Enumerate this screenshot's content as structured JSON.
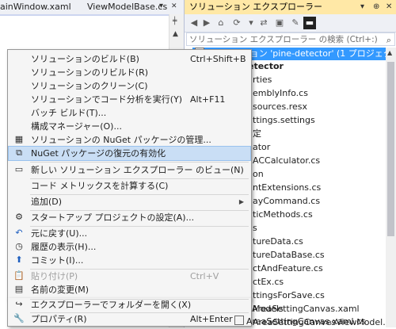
{
  "editor": {
    "tab1": "ainWindow.xaml",
    "tab2": "ViewModelBase.cs"
  },
  "solution_explorer": {
    "title": "ソリューション エクスプローラー",
    "title_buttons": [
      "▾",
      "⊕",
      "✕"
    ],
    "search_placeholder": "ソリューション エクスプローラー の検索 (Ctrl+:)",
    "tree": [
      "ソリューション 'pine-detector' (1 プロジェクト)",
      "etector",
      "rties",
      "emblyInfo.cs",
      "sources.resx",
      "ttings.settings",
      "定",
      "ator",
      "ACCalculator.cs",
      "on",
      "ntExtensions.cs",
      "ayCommand.cs",
      "ticMethods.cs",
      "s",
      "tureData.cs",
      "tureDataBase.cs",
      "ctAndFeature.cs",
      "ctEx.cs",
      "ttingsForSave.cs",
      "Models",
      "AreaSettingCanvesViewModel.cs",
      "inWindowViewModel.cs",
      "wModelBase.cs",
      "",
      "AreaSettingCanvas.xaml",
      "AreaSettingCanvas.xaml.cs"
    ]
  },
  "context_menu": {
    "items": [
      {
        "label": "ソリューションのビルド(B)",
        "shortcut": "Ctrl+Shift+B",
        "icon": ""
      },
      {
        "label": "ソリューションのリビルド(R)",
        "shortcut": "",
        "icon": ""
      },
      {
        "label": "ソリューションのクリーン(C)",
        "shortcut": "",
        "icon": ""
      },
      {
        "label": "ソリューションでコード分析を実行(Y)",
        "shortcut": "Alt+F11",
        "icon": ""
      },
      {
        "label": "バッチ ビルド(T)...",
        "shortcut": "",
        "icon": ""
      },
      {
        "label": "構成マネージャー(O)...",
        "shortcut": "",
        "icon": ""
      },
      {
        "label": "ソリューションの NuGet パッケージの管理...",
        "shortcut": "",
        "icon": "nuget-icon"
      },
      {
        "label": "NuGet パッケージの復元の有効化",
        "shortcut": "",
        "icon": "nuget-restore-icon"
      },
      {
        "label": "新しい ソリューション エクスプローラー のビュー(N)",
        "shortcut": "",
        "icon": "new-view-icon"
      },
      {
        "label": "コード メトリックスを計算する(C)",
        "shortcut": "",
        "icon": ""
      },
      {
        "label": "追加(D)",
        "shortcut": "",
        "icon": ""
      },
      {
        "label": "スタートアップ プロジェクトの設定(A)...",
        "shortcut": "",
        "icon": "gear-icon"
      },
      {
        "label": "元に戻す(U)...",
        "shortcut": "",
        "icon": "undo-icon"
      },
      {
        "label": "履歴の表示(H)...",
        "shortcut": "",
        "icon": "history-icon"
      },
      {
        "label": "コミット(I)...",
        "shortcut": "",
        "icon": "commit-icon"
      },
      {
        "label": "貼り付け(P)",
        "shortcut": "Ctrl+V",
        "icon": "paste-icon"
      },
      {
        "label": "名前の変更(M)",
        "shortcut": "",
        "icon": "rename-icon"
      },
      {
        "label": "エクスプローラーでフォルダーを開く(X)",
        "shortcut": "",
        "icon": "open-folder-icon"
      },
      {
        "label": "プロパティ(R)",
        "shortcut": "Alt+Enter",
        "icon": "wrench-icon"
      }
    ]
  },
  "colors": {
    "title_bar": "#ffe8a6",
    "menu_highlight": "#c9def5",
    "tree_selection": "#3399ff"
  }
}
